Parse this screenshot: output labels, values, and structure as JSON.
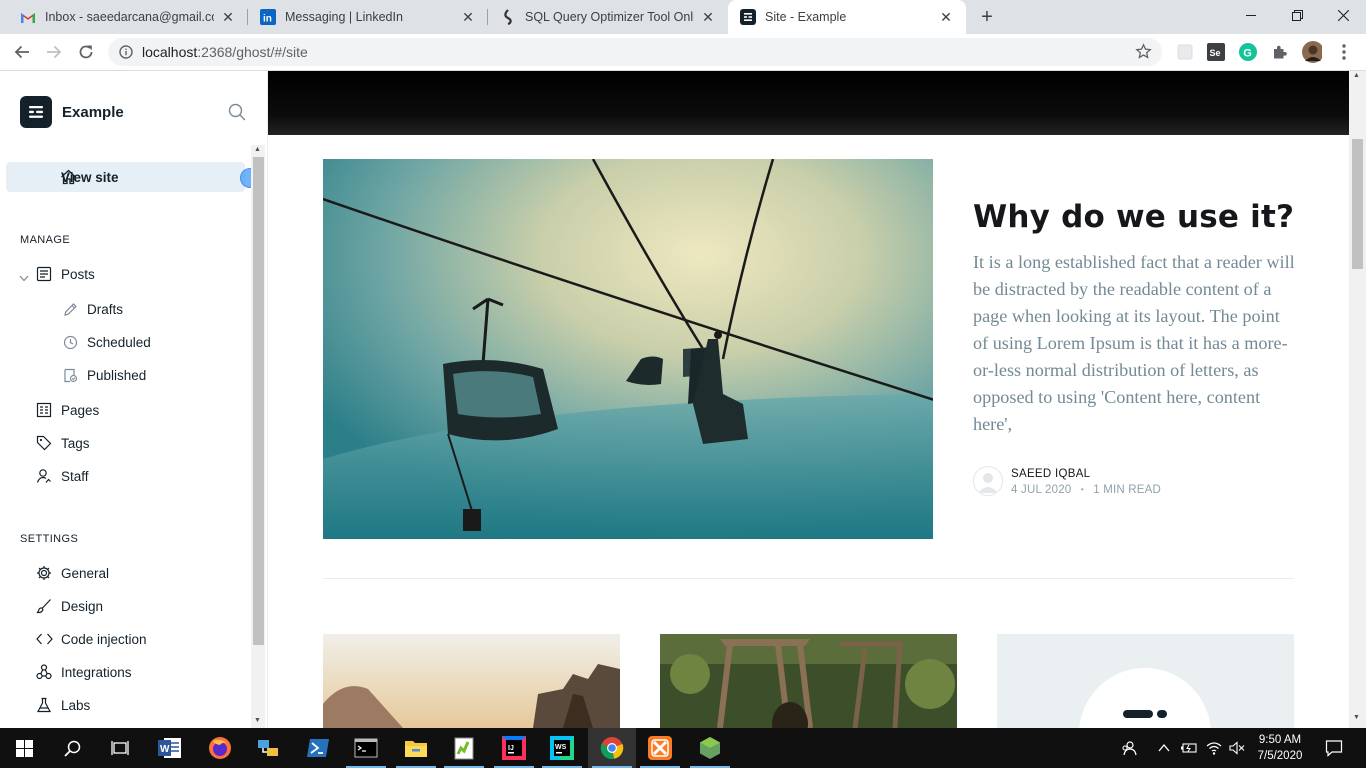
{
  "browser": {
    "tabs": [
      {
        "title": "Inbox - saeedarcana@gmail.com",
        "icon": "gmail-icon"
      },
      {
        "title": "Messaging | LinkedIn",
        "icon": "linkedin-icon"
      },
      {
        "title": "SQL Query Optimizer Tool Online",
        "icon": "sql-tool-icon"
      },
      {
        "title": "Site - Example",
        "icon": "ghost-icon"
      }
    ],
    "url_host": "localhost",
    "url_rest": ":2368/ghost/#/site"
  },
  "sidebar": {
    "site_name": "Example",
    "view_site": "View site",
    "manage_label": "MANAGE",
    "posts": "Posts",
    "drafts": "Drafts",
    "scheduled": "Scheduled",
    "published": "Published",
    "pages": "Pages",
    "tags": "Tags",
    "staff": "Staff",
    "settings_label": "SETTINGS",
    "general": "General",
    "design": "Design",
    "code_injection": "Code injection",
    "integrations": "Integrations",
    "labs": "Labs"
  },
  "post": {
    "title": "Why do we use it?",
    "excerpt": "It is a long established fact that a reader will be distracted by the readable content of a page when looking at its layout. The point of using Lorem Ipsum is that it has a more-or-less normal distribution of letters, as opposed to using 'Content here, content here',",
    "author": "SAEED IQBAL",
    "date": "4 JUL 2020",
    "read_time": "1 MIN READ"
  },
  "taskbar": {
    "time": "9:50 AM",
    "date": "7/5/2020"
  },
  "colors": {
    "ghost_dark": "#15212a",
    "active_nav_bg": "#e5eff5",
    "excerpt_text": "#738a94",
    "meta_text": "#90a2aa"
  }
}
